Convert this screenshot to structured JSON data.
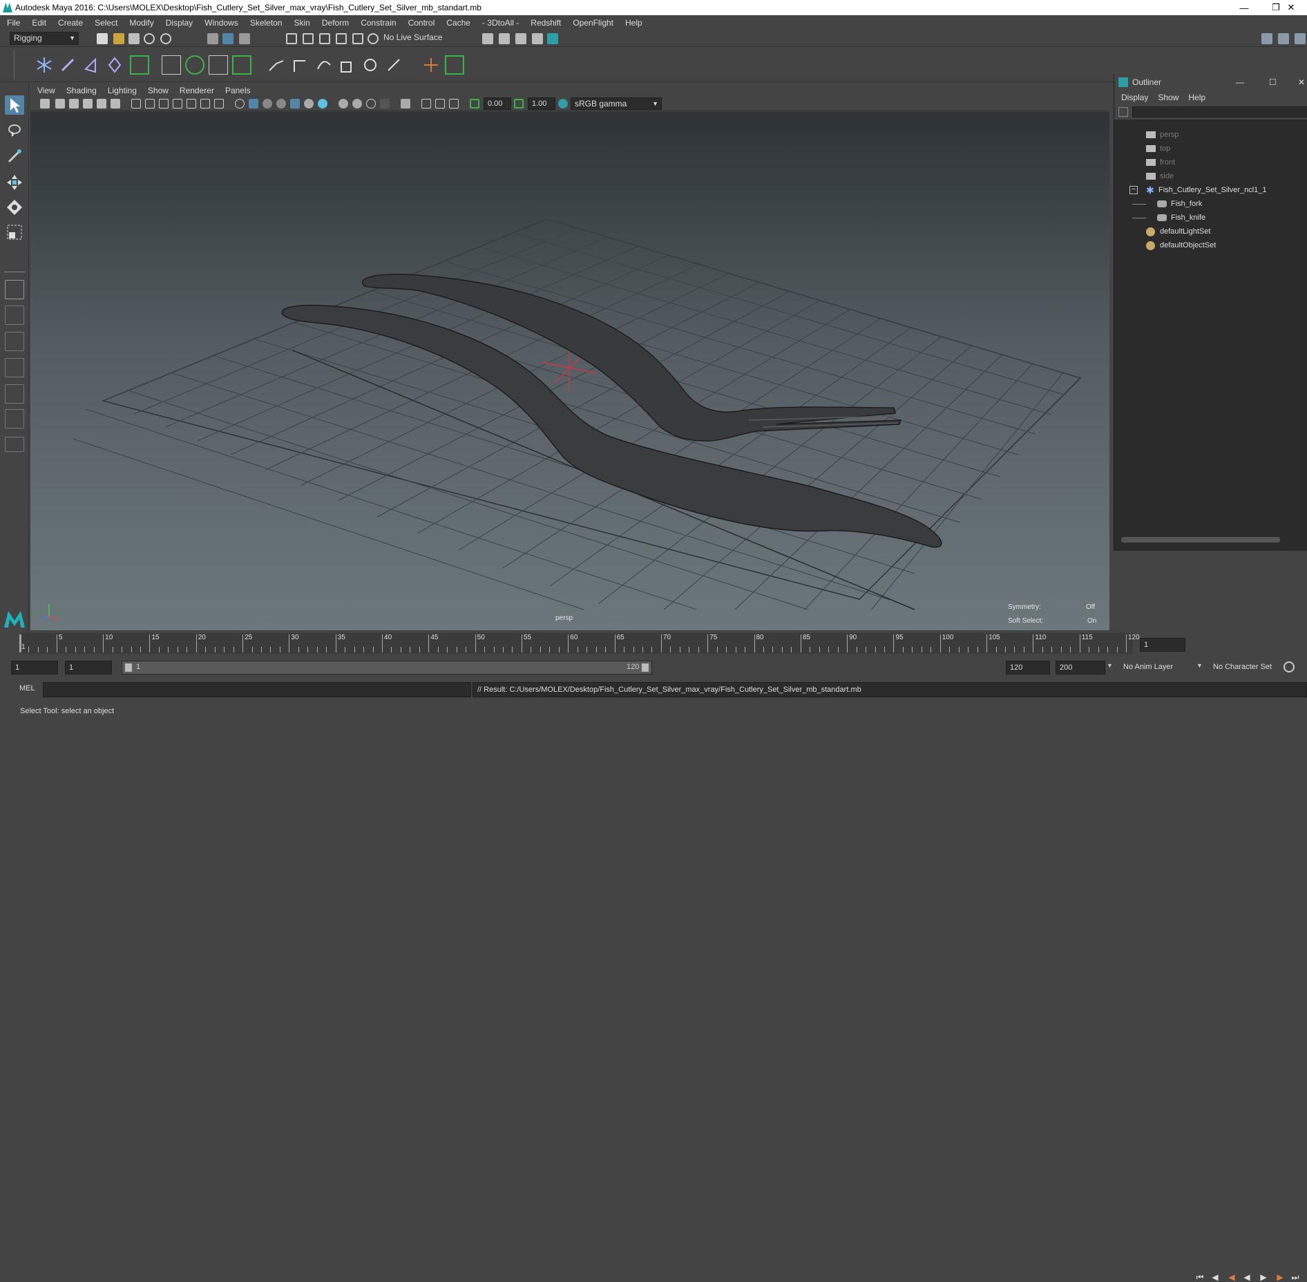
{
  "window": {
    "title": "Autodesk Maya 2016: C:\\Users\\MOLEX\\Desktop\\Fish_Cutlery_Set_Silver_max_vray\\Fish_Cutlery_Set_Silver_mb_standart.mb"
  },
  "menubar": [
    "File",
    "Edit",
    "Create",
    "Select",
    "Modify",
    "Display",
    "Windows",
    "Skeleton",
    "Skin",
    "Deform",
    "Constrain",
    "Control",
    "Cache",
    "- 3DtoAll -",
    "Redshift",
    "OpenFlight",
    "Help"
  ],
  "statusline": {
    "menuset": "Rigging",
    "live_surface": "No Live Surface"
  },
  "viewport": {
    "menu": [
      "View",
      "Shading",
      "Lighting",
      "Show",
      "Renderer",
      "Panels"
    ],
    "exposure": "0.00",
    "gamma": "1.00",
    "colorspace": "sRGB gamma",
    "camera_label": "persp",
    "symmetry_label": "Symmetry:",
    "symmetry_value": "Off",
    "soft_select_label": "Soft Select:",
    "soft_select_value": "On"
  },
  "outliner": {
    "title": "Outliner",
    "menu": [
      "Display",
      "Show",
      "Help"
    ],
    "items": [
      {
        "label": "persp",
        "icon": "camera-icon",
        "dim": true
      },
      {
        "label": "top",
        "icon": "camera-icon",
        "dim": true
      },
      {
        "label": "front",
        "icon": "camera-icon",
        "dim": true
      },
      {
        "label": "side",
        "icon": "camera-icon",
        "dim": true
      },
      {
        "label": "Fish_Cutlery_Set_Silver_ncl1_1",
        "icon": "group-icon",
        "dim": false
      },
      {
        "label": "Fish_fork",
        "icon": "mesh-icon",
        "dim": false
      },
      {
        "label": "Fish_knife",
        "icon": "mesh-icon",
        "dim": false
      },
      {
        "label": "defaultLightSet",
        "icon": "set-icon",
        "dim": false
      },
      {
        "label": "defaultObjectSet",
        "icon": "set-icon",
        "dim": false
      }
    ]
  },
  "timeslider": {
    "ticks": [
      "1",
      "5",
      "10",
      "15",
      "20",
      "25",
      "30",
      "35",
      "40",
      "45",
      "50",
      "55",
      "60",
      "65",
      "70",
      "75",
      "80",
      "85",
      "90",
      "95",
      "100",
      "105",
      "110",
      "115",
      "120"
    ],
    "current_frame": "1"
  },
  "range": {
    "start": "1",
    "playback_start": "1",
    "slider_start": "1",
    "slider_end": "120",
    "playback_end": "120",
    "end": "200",
    "anim_layer": "No Anim Layer",
    "character_set": "No Character Set"
  },
  "cmdline": {
    "lang": "MEL",
    "result": "// Result: C:/Users/MOLEX/Desktop/Fish_Cutlery_Set_Silver_max_vray/Fish_Cutlery_Set_Silver_mb_standart.mb"
  },
  "helpline": "Select Tool: select an object",
  "colors": {
    "accent": "#4fb3c9",
    "active_tool": "#5285a6",
    "bg": "#444444",
    "dark": "#2b2b2b"
  }
}
